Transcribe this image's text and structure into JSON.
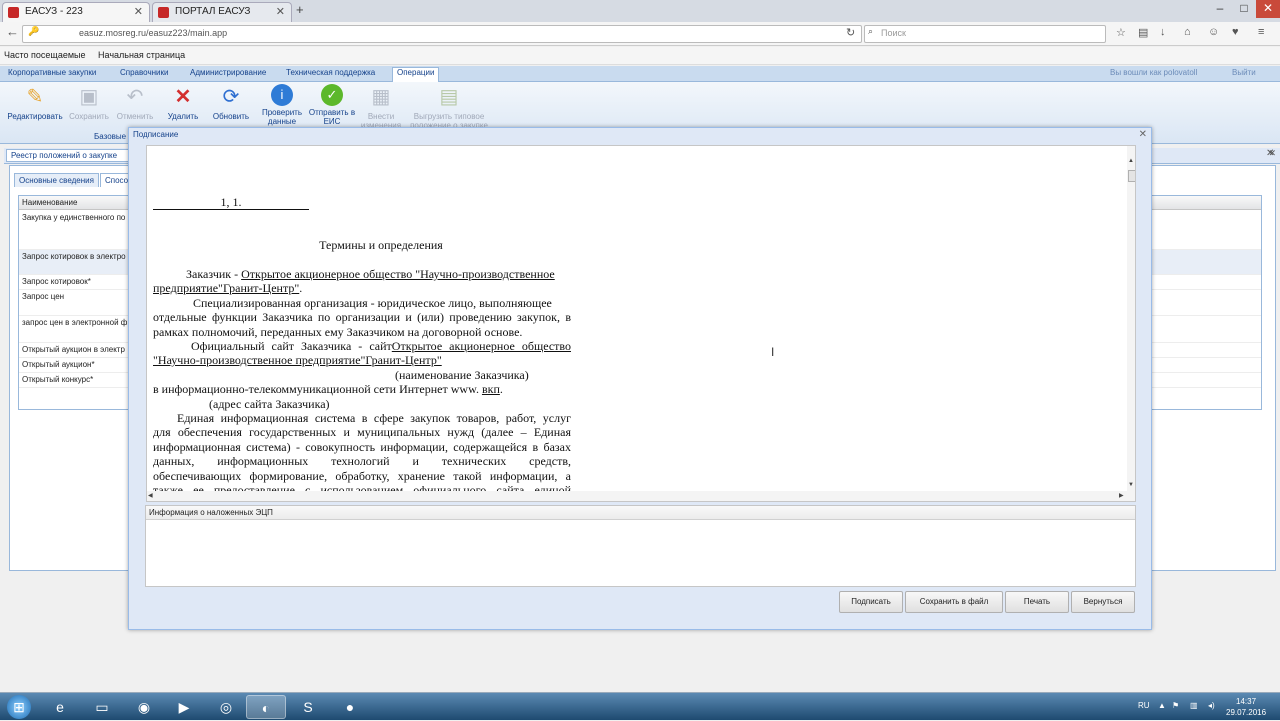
{
  "browser": {
    "tabs": [
      {
        "title": "ЕАСУЗ - 223",
        "active": true
      },
      {
        "title": "ПОРТАЛ ЕАСУЗ",
        "active": false
      }
    ],
    "new_tab_icon": "plus-icon",
    "url": "easuz.mosreg.ru/easuz223/main.app",
    "search_placeholder": "Поиск",
    "bookmarks": [
      "Часто посещаемые",
      "Начальная страница"
    ]
  },
  "app": {
    "menu": [
      {
        "label": "Корпоративные закупки",
        "active": false
      },
      {
        "label": "Справочники",
        "active": false
      },
      {
        "label": "Администрирование",
        "active": false
      },
      {
        "label": "Техническая поддержка",
        "active": false
      },
      {
        "label": "Операции",
        "active": true
      }
    ],
    "user_info": "Вы вошли как polovatoll",
    "logout": "Выйти",
    "toolbar": [
      {
        "label": "Редактировать",
        "icon": "pencil-icon",
        "enabled": true
      },
      {
        "label": "Сохранить",
        "icon": "floppy-icon",
        "enabled": false
      },
      {
        "label": "Отменить",
        "icon": "undo-icon",
        "enabled": false
      },
      {
        "label": "Удалить",
        "icon": "delete-icon",
        "enabled": true
      },
      {
        "label": "Обновить",
        "icon": "refresh-icon",
        "enabled": true
      },
      {
        "label": "Проверить данные",
        "icon": "info-icon",
        "enabled": true
      },
      {
        "label": "Отправить в ЕИС",
        "icon": "check-icon",
        "enabled": true
      },
      {
        "label": "Внести изменения",
        "icon": "grid-icon",
        "enabled": false
      },
      {
        "label": "Выгрузить типовое положение о закупке",
        "icon": "export-icon",
        "enabled": false
      }
    ],
    "toolbar_group": "Базовые",
    "registry_tab": "Реестр положений о закупке",
    "inner_tabs": [
      "Основные сведения",
      "Спосо"
    ],
    "grid_header": "Наименование",
    "grid_rows": [
      "Закупка у единственного по",
      "Запрос котировок в электро",
      "Запрос котировок*",
      "Запрос цен",
      "запрос цен в электронной ф",
      "Открытый аукцион в электр",
      "Открытый аукцион*",
      "Открытый конкурс*"
    ]
  },
  "dialog": {
    "title": "Подписание",
    "doc": {
      "heading_num": "1, 1.",
      "section_title": "Термины и определения",
      "p1_a": "Заказчик -",
      "p1_b": "Открытое акционерное общество \"Научно-производственное",
      "p1_c": "предприятие\"Гранит-Центр\"",
      "p2_a": "Специализированная организация - юридическое лицо, выполняющее",
      "p2_b": "отдельные функции Заказчика по организации и (или) проведению закупок, в",
      "p2_c": "рамках полномочий, переданных ему Заказчиком на договорной основе.",
      "p3_a": "Официальный сайт Заказчика - сайт",
      "p3_b": "Открытое акционерное общество",
      "p3_c": "\"Научно-производственное предприятие\"Гранит-Центр\"",
      "p3_note": "(наименование Заказчика)",
      "p3_d": "в информационно-телекоммуникационной сети Интернет www.",
      "p3_link": "вкп",
      "p3_note2": "(адрес сайта   Заказчика)",
      "p4_a": "Единая информационная система в сфере закупок товаров, работ,  услуг",
      "p4_b": "для обеспечения государственных и муниципальных нужд (далее – Единая",
      "p4_c": "информационная система) - совокупность информации, содержащейся в базах",
      "p4_d": "данных,   информационных   технологий   и   технических   средств,",
      "p4_e": "обеспечивающих формирование, обработку, хранение такой информации, а",
      "p4_f": "также ее предоставление с использованием официального сайта единой"
    },
    "signature_header": "Информация о наложенных ЭЦП",
    "buttons": {
      "sign": "Подписать",
      "save_file": "Сохранить в файл",
      "print": "Печать",
      "back": "Вернуться"
    }
  },
  "taskbar": {
    "apps": [
      "start-orb-icon",
      "ie-icon",
      "explorer-icon",
      "media-icon",
      "player-icon",
      "chrome-icon",
      "firefox-icon",
      "skype-icon",
      "obs-icon"
    ],
    "lang": "RU",
    "time": "14:37",
    "date": "29.07.2016"
  }
}
